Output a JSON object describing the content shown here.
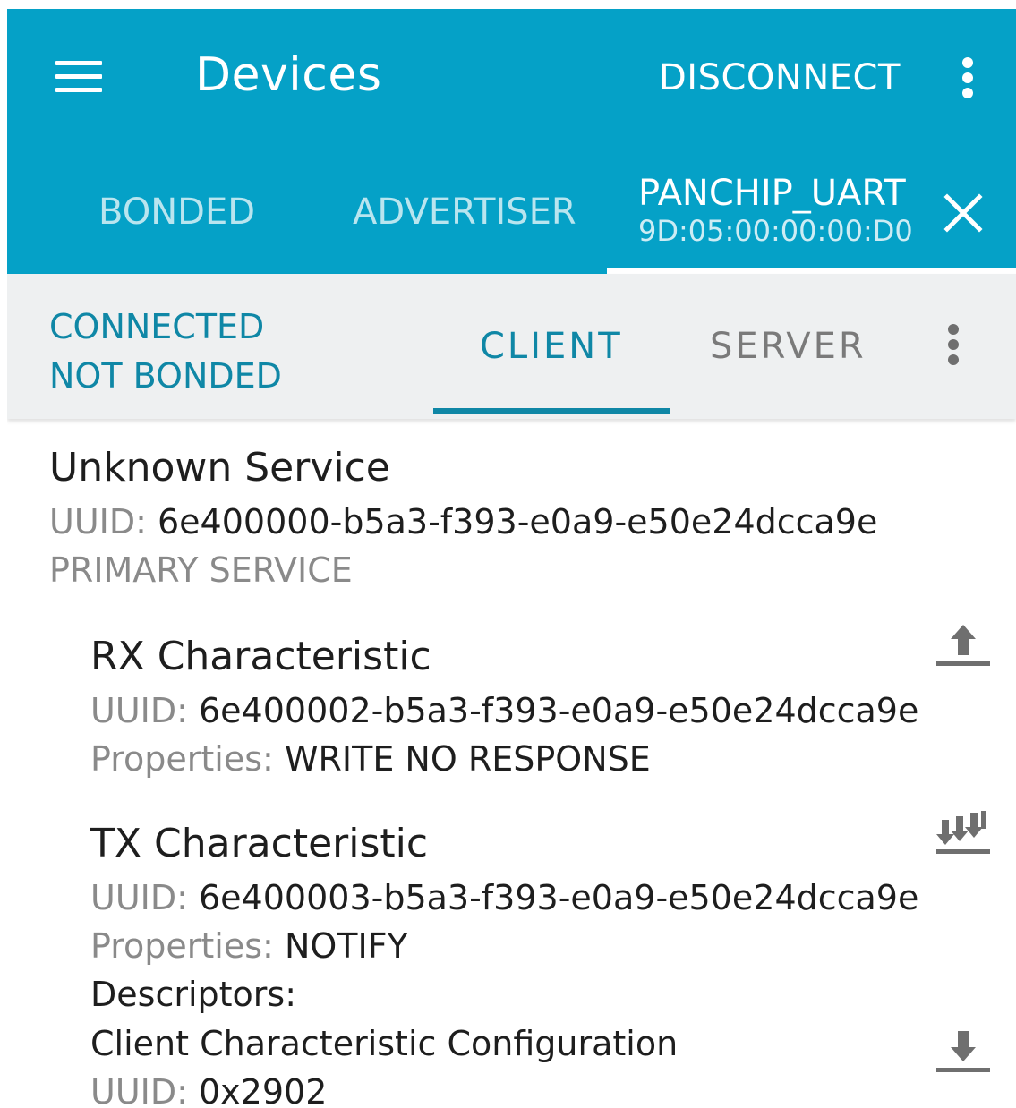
{
  "appbar": {
    "title": "Devices",
    "disconnect_label": "DISCONNECT",
    "icons": {
      "menu": "menu-icon",
      "overflow": "more-vert-icon"
    },
    "tabs": [
      {
        "label": "BONDED"
      },
      {
        "label": "ADVERTISER"
      },
      {
        "label": "PANCHIP_UART",
        "sublabel": "9D:05:00:00:00:D0",
        "selected": true
      }
    ],
    "close_icon": "close-icon"
  },
  "connection": {
    "status_line1": "CONNECTED",
    "status_line2": "NOT BONDED",
    "tabs": [
      {
        "label": "CLIENT",
        "selected": true
      },
      {
        "label": "SERVER",
        "selected": false
      }
    ]
  },
  "service": {
    "name": "Unknown Service",
    "uuid_label": "UUID:",
    "uuid": "6e400000-b5a3-f393-e0a9-e50e24dcca9e",
    "type": "PRIMARY SERVICE"
  },
  "characteristics": [
    {
      "name": "RX Characteristic",
      "uuid_label": "UUID:",
      "uuid": "6e400002-b5a3-f393-e0a9-e50e24dcca9e",
      "properties_label": "Properties:",
      "properties": "WRITE NO RESPONSE",
      "action_icon": "upload-icon"
    },
    {
      "name": "TX Characteristic",
      "uuid_label": "UUID:",
      "uuid": "6e400003-b5a3-f393-e0a9-e50e24dcca9e",
      "properties_label": "Properties:",
      "properties": "NOTIFY",
      "action_icon": "notify-download-icon",
      "descriptors_label": "Descriptors:",
      "descriptors": [
        {
          "name": "Client Characteristic Configuration",
          "uuid_label": "UUID:",
          "uuid": "0x2902",
          "action_icon": "download-icon"
        }
      ]
    }
  ],
  "colors": {
    "appbar": "#05a1c7",
    "accent": "#0f87a6",
    "connbar_bg": "#eef0f1",
    "text_primary": "#1e1e1e",
    "text_secondary": "#8a8a8a"
  }
}
